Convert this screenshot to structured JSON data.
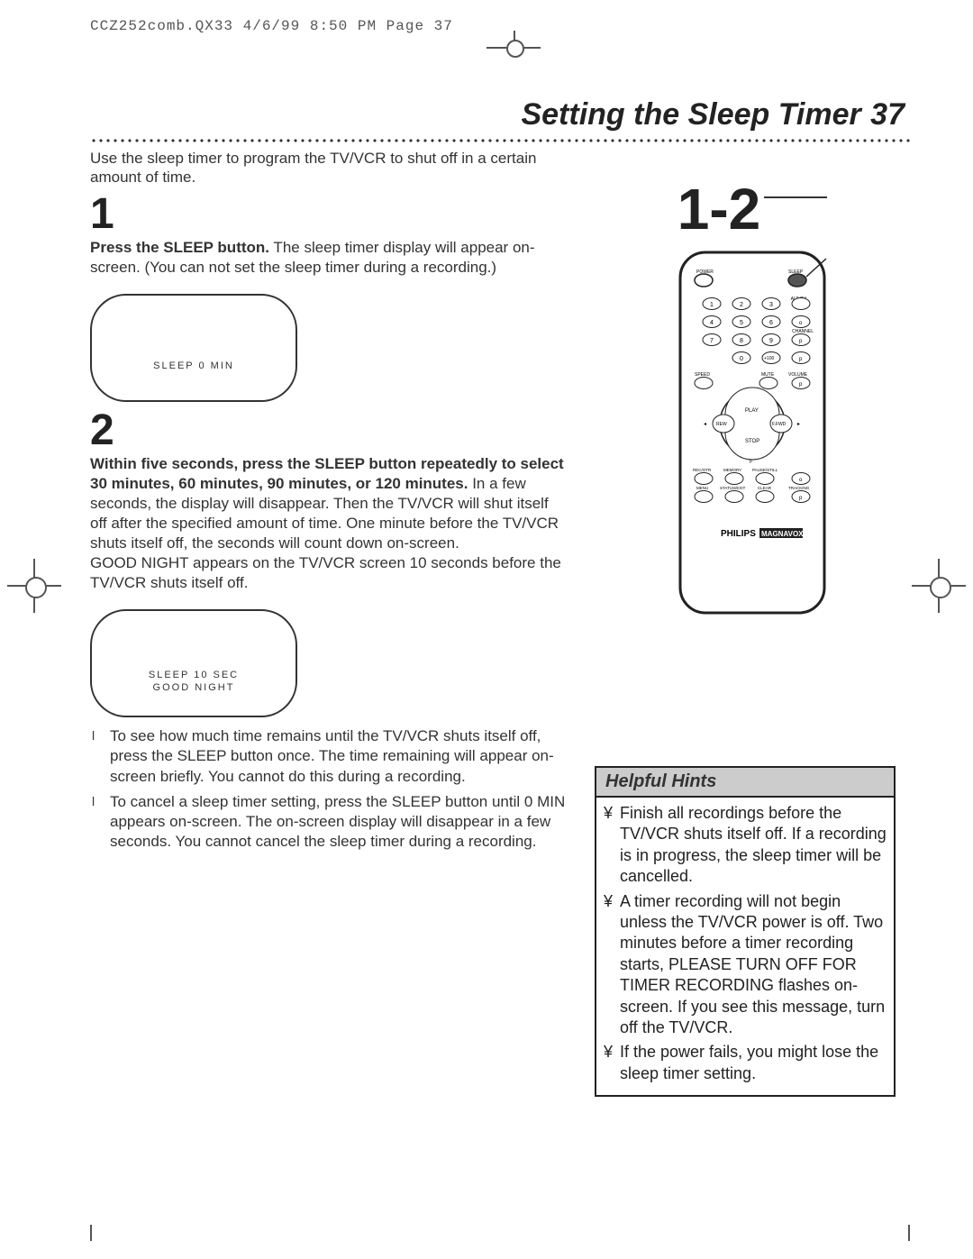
{
  "crop": {
    "header": "CCZ252comb.QX33  4/6/99 8:50 PM  Page 37"
  },
  "title": "Setting the Sleep Timer",
  "page_number": "37",
  "intro": "Use the sleep timer to program the TV/VCR to shut off in a certain amount of time.",
  "step1": {
    "num": "1",
    "bold": "Press the SLEEP button.",
    "rest": " The sleep timer display will appear on-screen. (You can not set the sleep timer during a recording.)"
  },
  "tv1": {
    "line1": "SLEEP    0   MIN"
  },
  "step2": {
    "num": "2",
    "bold": "Within five seconds, press the SLEEP button repeatedly to select 30 minutes, 60 minutes, 90 minutes, or 120 minutes.",
    "rest": " In a few seconds, the display will disappear. Then the TV/VCR will shut itself off after the specified amount of time. One minute before the TV/VCR shuts itself off, the seconds will count down on-screen.",
    "extra": "GOOD NIGHT appears on the TV/VCR screen 10 seconds before the TV/VCR shuts itself off."
  },
  "tv2": {
    "line1": "SLEEP   10   SEC",
    "line2": "GOOD NIGHT"
  },
  "bullets": [
    "To see how much time remains until the TV/VCR shuts itself off, press the SLEEP button once. The time remaining will appear on-screen briefly. You cannot do this during a recording.",
    "To cancel a sleep timer setting, press the SLEEP button until 0 MIN appears on-screen. The on-screen display will disappear in a few seconds. You cannot cancel the sleep timer during a recording."
  ],
  "diagram_num": "1-2",
  "remote": {
    "labels": {
      "power": "POWER",
      "sleep": "SLEEP",
      "altch": "ALT CH",
      "channel": "CHANNEL",
      "speed": "SPEED",
      "mute": "MUTE",
      "volume": "VOLUME",
      "play": "PLAY",
      "rew": "REW",
      "ffwd": "F.FWD",
      "stop": "STOP",
      "recotr": "REC/OTR",
      "memory": "MEMORY",
      "pausestill": "PAUSE/STILL",
      "menu": "MENU",
      "statusexit": "STATUS/EXIT",
      "clear": "CLEAR",
      "tracking": "TRACKING",
      "plus100": "+100",
      "brand": "PHILIPS",
      "brand2": "MAGNAVOX",
      "o": "o",
      "p": "p"
    },
    "nums": [
      "1",
      "2",
      "3",
      "4",
      "5",
      "6",
      "7",
      "8",
      "9",
      "0"
    ]
  },
  "hints": {
    "title": "Helpful Hints",
    "items": [
      "Finish all recordings before the TV/VCR shuts itself off. If a recording is in progress, the sleep timer will be cancelled.",
      "A timer recording will not begin unless the TV/VCR power is off. Two minutes before a timer recording starts, PLEASE TURN OFF FOR TIMER RECORDING flashes on-screen. If you see this message, turn off the TV/VCR.",
      "If the power fails, you might lose the sleep timer setting."
    ]
  }
}
